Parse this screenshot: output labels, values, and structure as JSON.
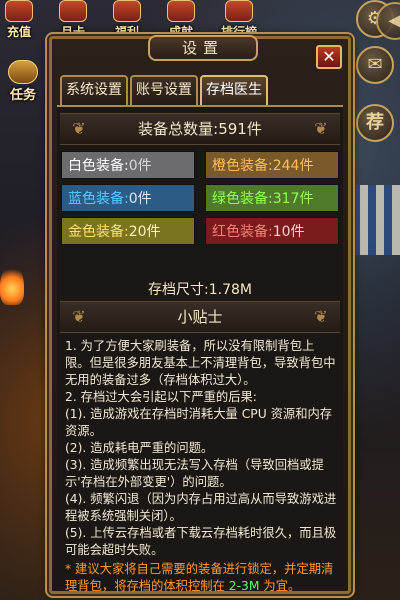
{
  "hud": {
    "top": [
      {
        "label": "充值"
      },
      {
        "label": "月卡"
      },
      {
        "label": "福利"
      },
      {
        "label": "成就"
      },
      {
        "label": "排行榜"
      }
    ],
    "left": [
      {
        "label": "任务"
      }
    ],
    "right_icons": [
      "settings-gear",
      "speaker",
      "mail",
      "pet"
    ],
    "right_label": "荐"
  },
  "dialog": {
    "title": "设置",
    "close": "✕",
    "tabs": [
      {
        "label": "系统设置",
        "active": false
      },
      {
        "label": "账号设置",
        "active": false
      },
      {
        "label": "存档医生",
        "active": true
      }
    ],
    "total": {
      "label": "装备总数量:",
      "value": "591件"
    },
    "equip": [
      {
        "label": "白色装备:",
        "value": "0件",
        "color": "#ffffff"
      },
      {
        "label": "橙色装备:",
        "value": "244件",
        "color": "#ffbe5c"
      },
      {
        "label": "蓝色装备:",
        "value": "0件",
        "color": "#5ec8ff"
      },
      {
        "label": "绿色装备:",
        "value": "317件",
        "color": "#98ff5a"
      },
      {
        "label": "金色装备:",
        "value": "20件",
        "color": "#ffe06a"
      },
      {
        "label": "红色装备:",
        "value": "10件",
        "color": "#ff7f7f"
      }
    ],
    "save_size": {
      "label": "存档尺寸:",
      "value": "1.78M"
    },
    "tips_title": "小贴士",
    "tips": [
      "1. 为了方便大家刷装备，所以没有限制背包上限。但是很多朋友基本上不清理背包，导致背包中无用的装备过多（存档体积过大）。",
      "2. 存档过大会引起以下严重的后果:",
      "(1). 造成游戏在存档时消耗大量 CPU 资源和内存资源。",
      "(2). 造成耗电严重的问题。",
      "(3). 造成频繁出现无法写入存档（导致回档或提示'存档在外部变更'）的问题。",
      "(4). 频繁闪退（因为内存占用过高从而导致游戏进程被系统强制关闭）。",
      "(5). 上传云存档或者下载云存档耗时很久，而且极可能会超时失败。"
    ],
    "hint_prefix": "* 建议大家将自己需要的装备进行锁定，并定期清理背包，将存档的体积控制在 ",
    "hint_range": "2-3M",
    "hint_suffix": " 为宜。"
  }
}
